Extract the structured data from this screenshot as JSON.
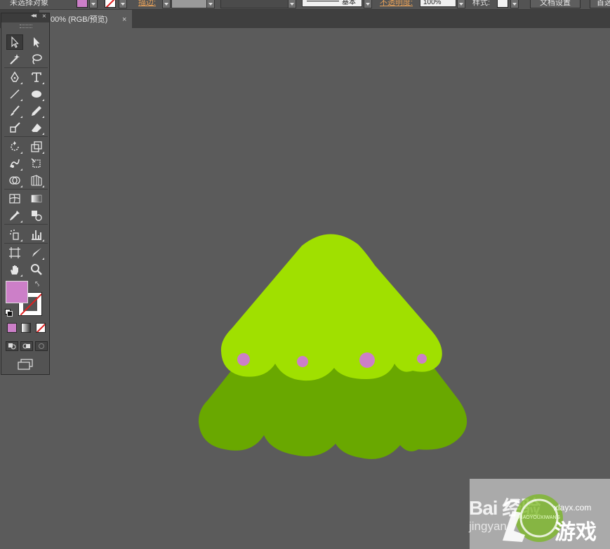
{
  "control_bar": {
    "selection_status": "未选择对象",
    "stroke_label": "描边:",
    "stroke_profile": "基本",
    "opacity_label": "不透明度:",
    "opacity_value": "100%",
    "style_label": "样式:",
    "doc_setup_button": "文档设置",
    "preferences_button": "首选",
    "fill_color": "#cc7fc8"
  },
  "document_tab": {
    "label": "00% (RGB/预览)",
    "close": "×"
  },
  "tools_panel": {
    "collapse": "◂◂",
    "close": "×",
    "tools": [
      "selection-tool",
      "direct-selection-tool",
      "magic-wand-tool",
      "lasso-tool",
      "pen-tool",
      "type-tool",
      "line-segment-tool",
      "ellipse-tool",
      "paintbrush-tool",
      "pencil-tool",
      "blob-brush-tool",
      "eraser-tool",
      "rotate-tool",
      "scale-tool",
      "warp-tool",
      "free-transform-tool",
      "shape-builder-tool",
      "perspective-grid-tool",
      "mesh-tool",
      "gradient-tool",
      "eyedropper-tool",
      "blend-tool",
      "symbol-sprayer-tool",
      "column-graph-tool",
      "artboard-tool",
      "slice-tool",
      "hand-tool",
      "zoom-tool"
    ],
    "fill_color": "#cc7fc8",
    "stroke": "none"
  },
  "artwork": {
    "light_green": "#a0e000",
    "dark_green": "#69a800",
    "ornament_color": "#cc7fc8",
    "canvas_bg": "#5b5b5b"
  },
  "watermark": {
    "baidu": "Bai 经验",
    "jingyan": "jingyan",
    "site": "xlayx.com",
    "game": "游戏",
    "logo_text": "XIAOYOUXIWANG"
  }
}
